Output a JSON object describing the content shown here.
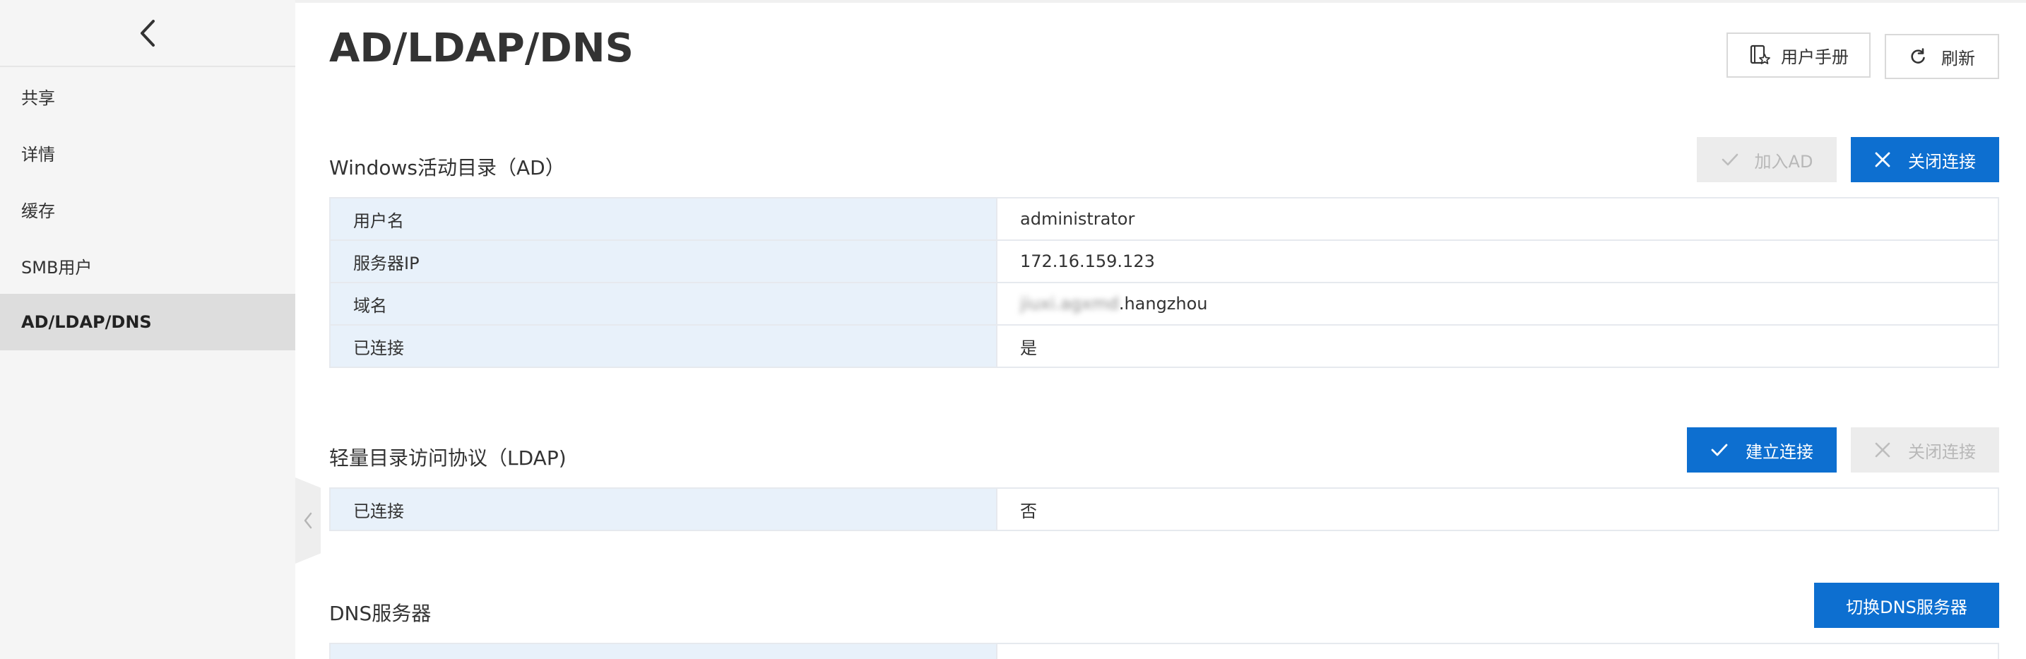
{
  "sidebar": {
    "items": [
      {
        "label": "共享"
      },
      {
        "label": "详情"
      },
      {
        "label": "缓存"
      },
      {
        "label": "SMB用户"
      },
      {
        "label": "AD/LDAP/DNS"
      }
    ],
    "active_index": 4
  },
  "header": {
    "title": "AD/LDAP/DNS",
    "manual_label": "用户手册",
    "refresh_label": "刷新"
  },
  "ad": {
    "title": "Windows活动目录（AD）",
    "join_label": "加入AD",
    "close_label": "关闭连接",
    "rows": [
      {
        "key": "用户名",
        "value": "administrator"
      },
      {
        "key": "服务器IP",
        "value": "172.16.159.123"
      },
      {
        "key": "域名",
        "value_blurred": "jiuxi.agxmd",
        "value": ".hangzhou"
      },
      {
        "key": "已连接",
        "value": "是"
      }
    ]
  },
  "ldap": {
    "title": "轻量目录访问协议（LDAP)",
    "connect_label": "建立连接",
    "close_label": "关闭连接",
    "rows": [
      {
        "key": "已连接",
        "value": "否"
      }
    ]
  },
  "dns": {
    "title": "DNS服务器",
    "switch_label": "切换DNS服务器"
  },
  "colors": {
    "primary": "#0d6fd0",
    "key_cell_bg": "#e8f1fa",
    "sidebar_bg": "#f5f5f5",
    "active_item_bg": "#dddddd",
    "disabled_bg": "#ececec"
  }
}
